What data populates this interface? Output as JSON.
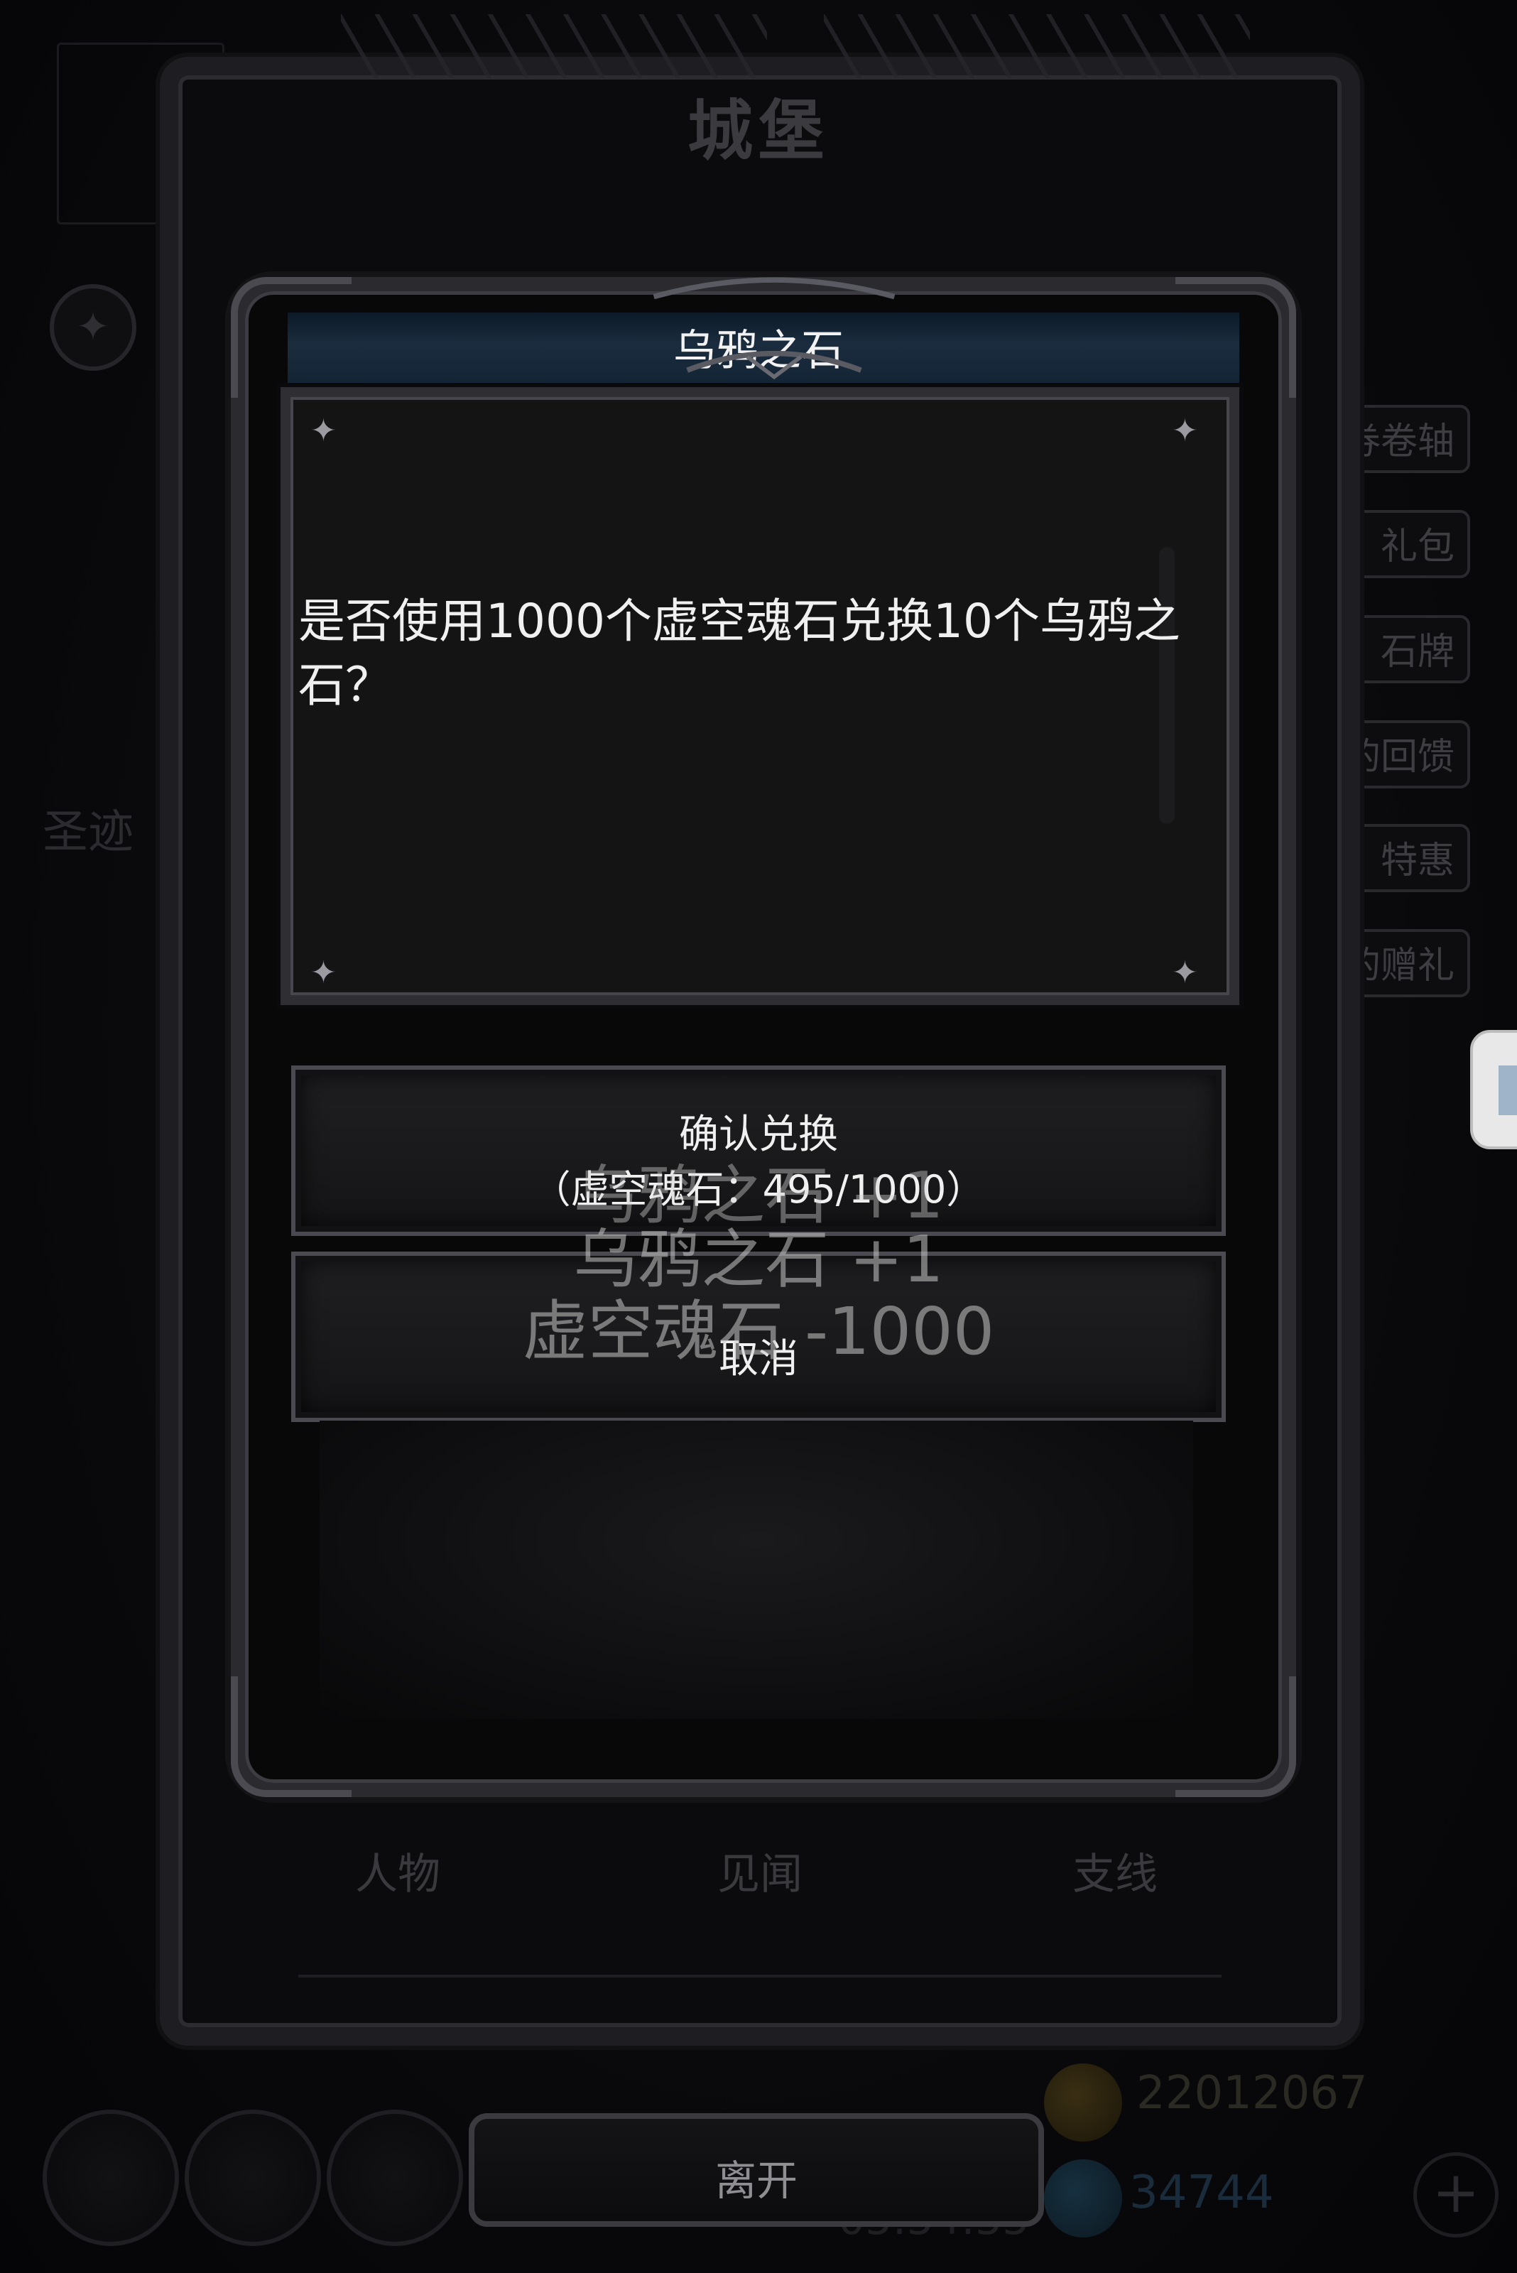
{
  "castle": {
    "title": "城堡",
    "tabs": [
      "人物",
      "见闻",
      "支线"
    ]
  },
  "background": {
    "side_menu": [
      "券卷轴",
      "礼包",
      "石牌",
      "的回馈",
      "特惠",
      "的赠礼"
    ],
    "shengji_label": "圣迹",
    "gold_amount": "22012067",
    "gem_amount": "34744",
    "timer": "05:54:55"
  },
  "dialog": {
    "title": "乌鸦之石",
    "message": "是否使用1000个虚空魂石兑换10个乌鸦之石？",
    "confirm_label": "确认兑换",
    "confirm_cost": "（虚空魂石：495/1000）",
    "cancel_label": "取消"
  },
  "floating_rewards": [
    "乌鸦之石 +1",
    "乌鸦之石 +1",
    "虚空魂石 -1000"
  ],
  "leave_label": "离开",
  "colors": {
    "title_bar": "#1a2c3e",
    "frame": "#2a2a2f",
    "panel": "#141415",
    "text": "#f0f0f0"
  }
}
